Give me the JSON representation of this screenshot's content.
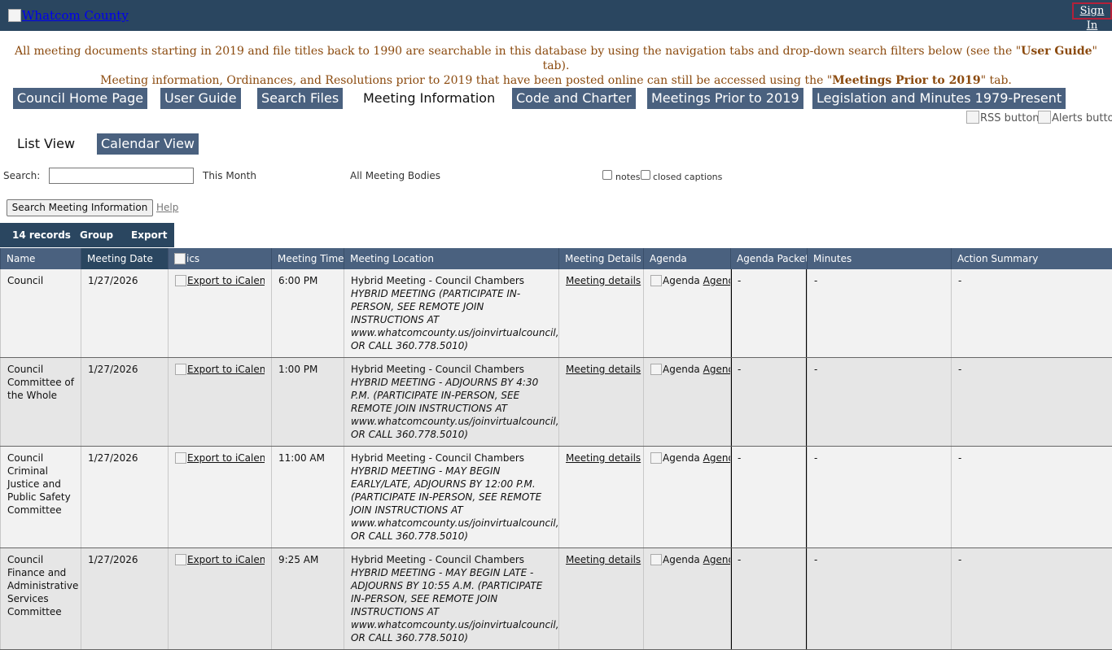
{
  "header": {
    "logo_alt": "Whatcom County",
    "sign_in": "Sign In"
  },
  "notice": {
    "line1_a": "All meeting documents starting in 2019 and file titles back to 1990 are searchable in this database by using the navigation tabs and drop-down search filters below (see the \"",
    "line1_b": "User Guide",
    "line1_c": "\" tab).",
    "line2_a": "Meeting information, Ordinances, and Resolutions prior to 2019 that have been posted online can still be accessed using the \"",
    "line2_b": "Meetings Prior to 2019",
    "line2_c": "\" tab."
  },
  "nav": {
    "tabs": [
      "Council Home Page",
      "User Guide",
      "Search Files",
      "Meeting Information",
      "Code and Charter",
      "Meetings Prior to 2019",
      "Legislation and Minutes 1979-Present"
    ]
  },
  "utility": {
    "rss": "RSS button",
    "alerts": "Alerts button"
  },
  "views": {
    "list": "List View",
    "calendar": "Calendar View"
  },
  "search": {
    "label": "Search:",
    "value": "",
    "period": "This Month",
    "bodies": "All Meeting Bodies",
    "notes": "notes",
    "captions": "closed captions",
    "button": "Search Meeting Information",
    "help": "Help"
  },
  "toolbar": {
    "records": "14 records",
    "group": "Group",
    "export": "Export"
  },
  "table": {
    "headers": [
      "Name",
      "Meeting Date",
      "ics",
      "Meeting Time",
      "Meeting Location",
      "Meeting Details",
      "Agenda",
      "Agenda Packet",
      "Minutes",
      "Action Summary"
    ],
    "rows": [
      {
        "name": "Council",
        "date": "1/27/2026",
        "ical": "Export to iCalendar",
        "time": "6:00 PM",
        "location": "Hybrid Meeting - Council Chambers",
        "location_note": "HYBRID MEETING (PARTICIPATE IN-PERSON, SEE REMOTE JOIN INSTRUCTIONS AT www.whatcomcounty.us/joinvirtualcouncil, OR CALL 360.778.5010)",
        "details": "Meeting details",
        "agenda_img": "Agenda",
        "agenda_link": "Agenda",
        "packet": "-",
        "minutes": "-",
        "summary": "-"
      },
      {
        "name": "Council Committee of the Whole",
        "date": "1/27/2026",
        "ical": "Export to iCalendar",
        "time": "1:00 PM",
        "location": "Hybrid Meeting - Council Chambers",
        "location_note": "HYBRID MEETING - ADJOURNS BY 4:30 P.M. (PARTICIPATE IN-PERSON, SEE REMOTE JOIN INSTRUCTIONS AT www.whatcomcounty.us/joinvirtualcouncil, OR CALL 360.778.5010)",
        "details": "Meeting details",
        "agenda_img": "Agenda",
        "agenda_link": "Agenda",
        "packet": "-",
        "minutes": "-",
        "summary": "-"
      },
      {
        "name": "Council Criminal Justice and Public Safety Committee",
        "date": "1/27/2026",
        "ical": "Export to iCalendar",
        "time": "11:00 AM",
        "location": "Hybrid Meeting - Council Chambers",
        "location_note": "HYBRID MEETING - MAY BEGIN EARLY/LATE, ADJOURNS BY 12:00 P.M. (PARTICIPATE IN-PERSON, SEE REMOTE JOIN INSTRUCTIONS AT www.whatcomcounty.us/joinvirtualcouncil, OR CALL 360.778.5010)",
        "details": "Meeting details",
        "agenda_img": "Agenda",
        "agenda_link": "Agenda",
        "packet": "-",
        "minutes": "-",
        "summary": "-"
      },
      {
        "name": "Council Finance and Administrative Services Committee",
        "date": "1/27/2026",
        "ical": "Export to iCalendar",
        "time": "9:25 AM",
        "location": "Hybrid Meeting - Council Chambers",
        "location_note": "HYBRID MEETING - MAY BEGIN LATE - ADJOURNS BY 10:55 A.M. (PARTICIPATE IN-PERSON, SEE REMOTE JOIN INSTRUCTIONS AT www.whatcomcounty.us/joinvirtualcouncil, OR CALL 360.778.5010)",
        "details": "Meeting details",
        "agenda_img": "Agenda",
        "agenda_link": "Agenda",
        "packet": "-",
        "minutes": "-",
        "summary": "-"
      }
    ]
  }
}
